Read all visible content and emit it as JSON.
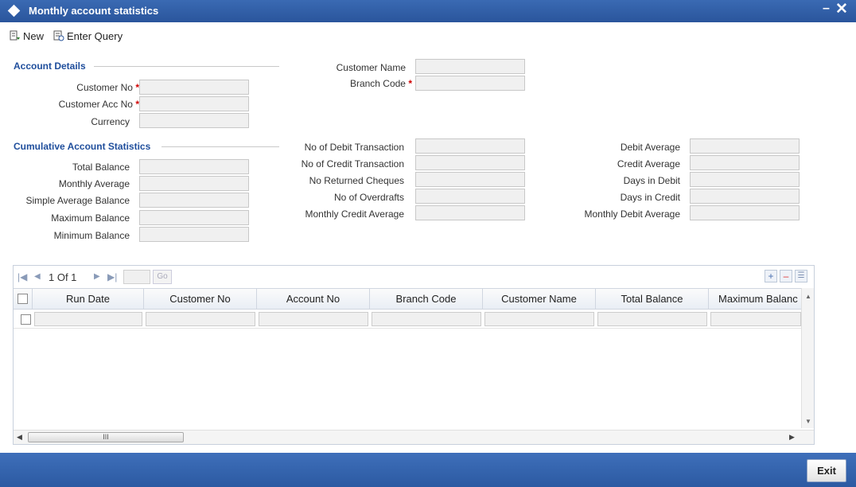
{
  "window": {
    "title": "Monthly account statistics",
    "minimize_glyph": "–",
    "close_glyph": "✕"
  },
  "toolbar": {
    "new_label": "New",
    "enter_query_label": "Enter Query"
  },
  "account_details": {
    "section_title": "Account Details",
    "customer_no_label": "Customer No",
    "customer_acc_no_label": "Customer Acc No",
    "currency_label": "Currency",
    "customer_name_label": "Customer Name",
    "branch_code_label": "Branch Code",
    "required_mark": "*"
  },
  "cumulative": {
    "section_title": "Cumulative Account Statistics",
    "total_balance_label": "Total Balance",
    "monthly_average_label": "Monthly Average",
    "simple_average_balance_label": "Simple Average Balance",
    "maximum_balance_label": "Maximum Balance",
    "minimum_balance_label": "Minimum Balance",
    "no_debit_txn_label": "No of Debit Transaction",
    "no_credit_txn_label": "No of Credit Transaction",
    "no_returned_cheques_label": "No Returned Cheques",
    "no_overdrafts_label": "No of Overdrafts",
    "monthly_credit_avg_label": "Monthly Credit Average",
    "debit_average_label": "Debit Average",
    "credit_average_label": "Credit Average",
    "days_in_debit_label": "Days in Debit",
    "days_in_credit_label": "Days in Credit",
    "monthly_debit_avg_label": "Monthly Debit Average"
  },
  "grid": {
    "pager_text": "1 Of 1",
    "go_label": "Go",
    "columns": [
      "Run Date",
      "Customer No",
      "Account No",
      "Branch Code",
      "Customer Name",
      "Total Balance",
      "Maximum Balanc"
    ],
    "scroll_thumb_glyph": "III"
  },
  "footer": {
    "exit_label": "Exit"
  },
  "colors": {
    "title_bar": "#2a559c",
    "section_title": "#1f4e9c",
    "required": "#d00000"
  }
}
